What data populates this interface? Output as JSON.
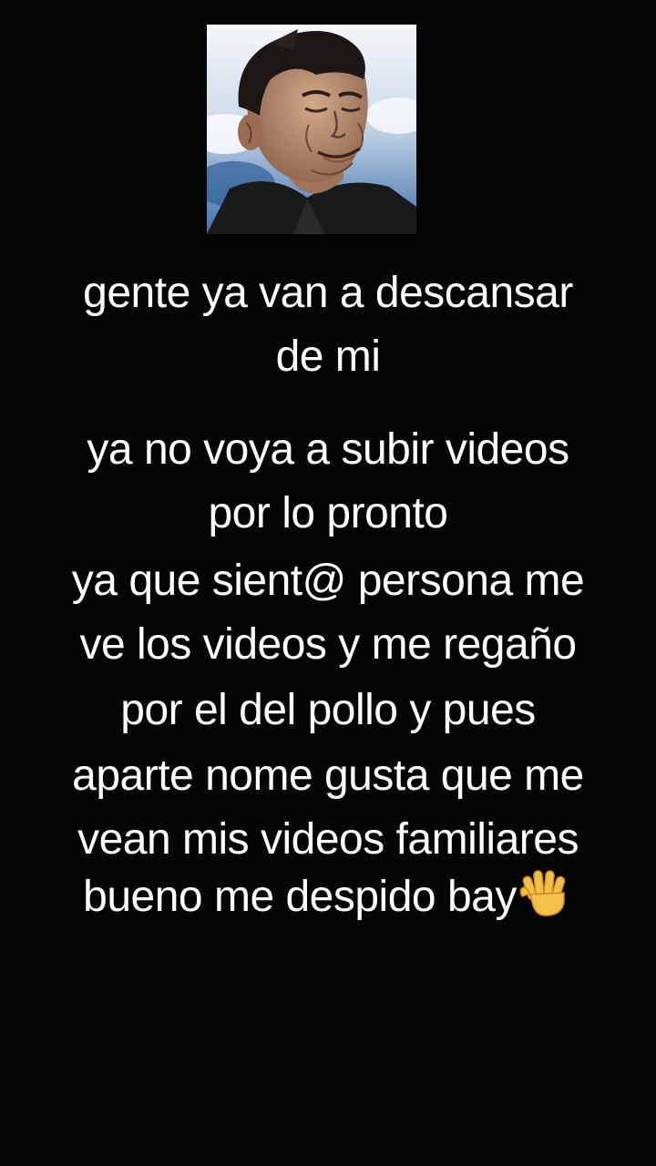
{
  "post": {
    "heading_lines": [
      "gente ya van a descansar",
      "de mi"
    ],
    "message_lines": [
      "ya no voya a subir videos",
      "por lo pronto",
      "ya que sient@ persona me",
      "ve los videos y me regaño",
      "por el del pollo y pues",
      "aparte nome gusta que me",
      "vean mis videos familiares",
      "bueno me despido bay"
    ],
    "closing_emoji": "raised-hand-icon"
  },
  "colors": {
    "background": "#050505",
    "text": "#ffffff",
    "sky": "#6f97c4",
    "emoji": "#f4c04a"
  }
}
